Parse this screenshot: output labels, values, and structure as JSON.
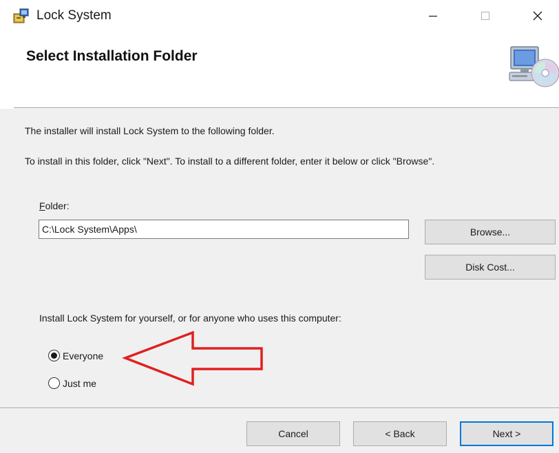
{
  "window": {
    "title": "Lock System",
    "minimize_glyph": "—",
    "maximize_glyph": "☐",
    "close_glyph": "✕",
    "app_icon": "installer-icon"
  },
  "header": {
    "title": "Select Installation Folder",
    "graphic": "computer-cd-icon"
  },
  "body": {
    "intro_line_1": "The installer will install Lock System to the following folder.",
    "intro_line_2": "To install in this folder, click \"Next\". To install to a different folder, enter it below or click \"Browse\".",
    "folder_label_accel": "F",
    "folder_label_rest": "older:",
    "folder_value": "C:\\Lock System\\Apps\\",
    "browse_label": "Browse...",
    "disk_cost_label": "Disk Cost...",
    "scope_prompt": "Install Lock System for yourself, or for anyone who uses this computer:",
    "options": [
      {
        "label": "Everyone",
        "selected": true
      },
      {
        "label": "Just me",
        "selected": false
      }
    ],
    "annotation": {
      "type": "arrow",
      "color": "#e02020",
      "points_to": "Everyone"
    }
  },
  "footer": {
    "cancel_label": "Cancel",
    "back_label": "< Back",
    "next_label": "Next >"
  },
  "colors": {
    "panel_bg": "#f0f0f0",
    "button_bg": "#e1e1e1",
    "default_button_border": "#0078d7",
    "annotation_red": "#e02020"
  }
}
